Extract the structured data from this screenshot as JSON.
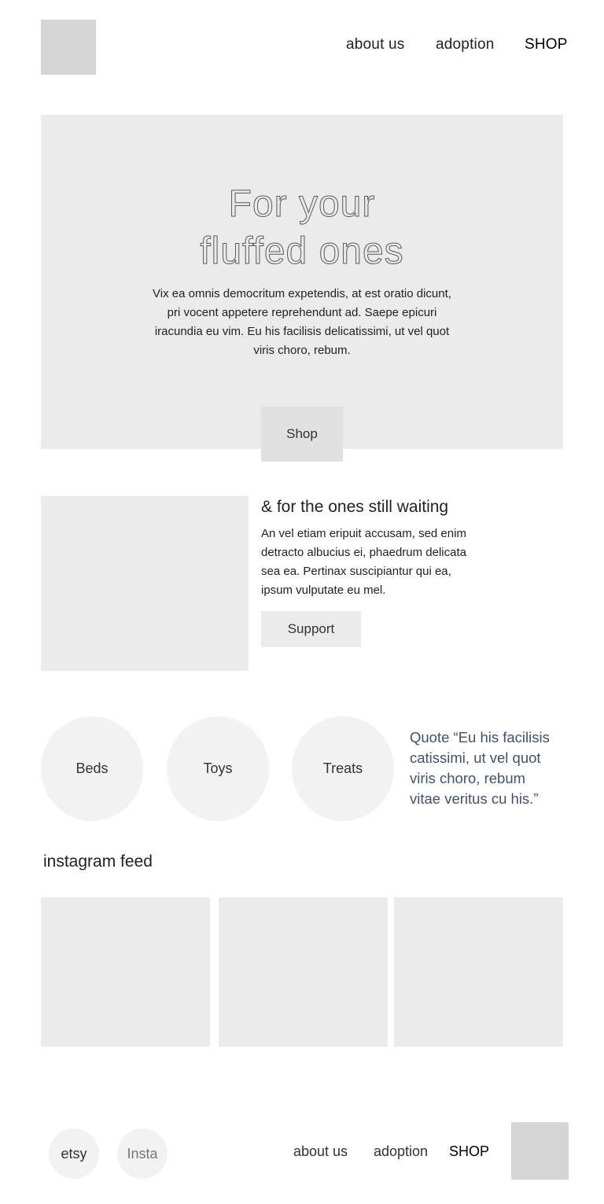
{
  "header": {
    "nav": {
      "about": "about us",
      "adoption": "adoption",
      "shop": "SHOP"
    }
  },
  "hero": {
    "title_line1": "For your",
    "title_line2": "fluffed ones",
    "text": "Vix ea omnis democritum expetendis, at est oratio dicunt, pri vocent appetere reprehendunt ad. Saepe epicuri iracundia eu vim. Eu his facilisis delicatissimi, ut vel quot viris choro, rebum.",
    "button": "Shop"
  },
  "waiting": {
    "title": "& for the ones still waiting",
    "text": "An vel etiam eripuit accusam, sed enim detracto albucius ei, phaedrum delicata sea ea. Pertinax suscipiantur qui ea, ipsum vulputate eu mel.",
    "button": "Support"
  },
  "categories": [
    "Beds",
    "Toys",
    "Treats"
  ],
  "quote": "Quote “Eu his facilisis catissimi, ut vel quot viris choro, rebum vitae veritus cu his.”",
  "instagram": {
    "title": "instagram feed"
  },
  "footer": {
    "social": {
      "etsy": "etsy",
      "insta": "Insta"
    },
    "nav": {
      "about": "about us",
      "adoption": "adoption",
      "shop": "SHOP"
    }
  },
  "colors": {
    "placeholder": "#ebebeb",
    "logo": "#d6d6d6",
    "circle": "#f2f2f2",
    "quote": "#3f5273"
  }
}
